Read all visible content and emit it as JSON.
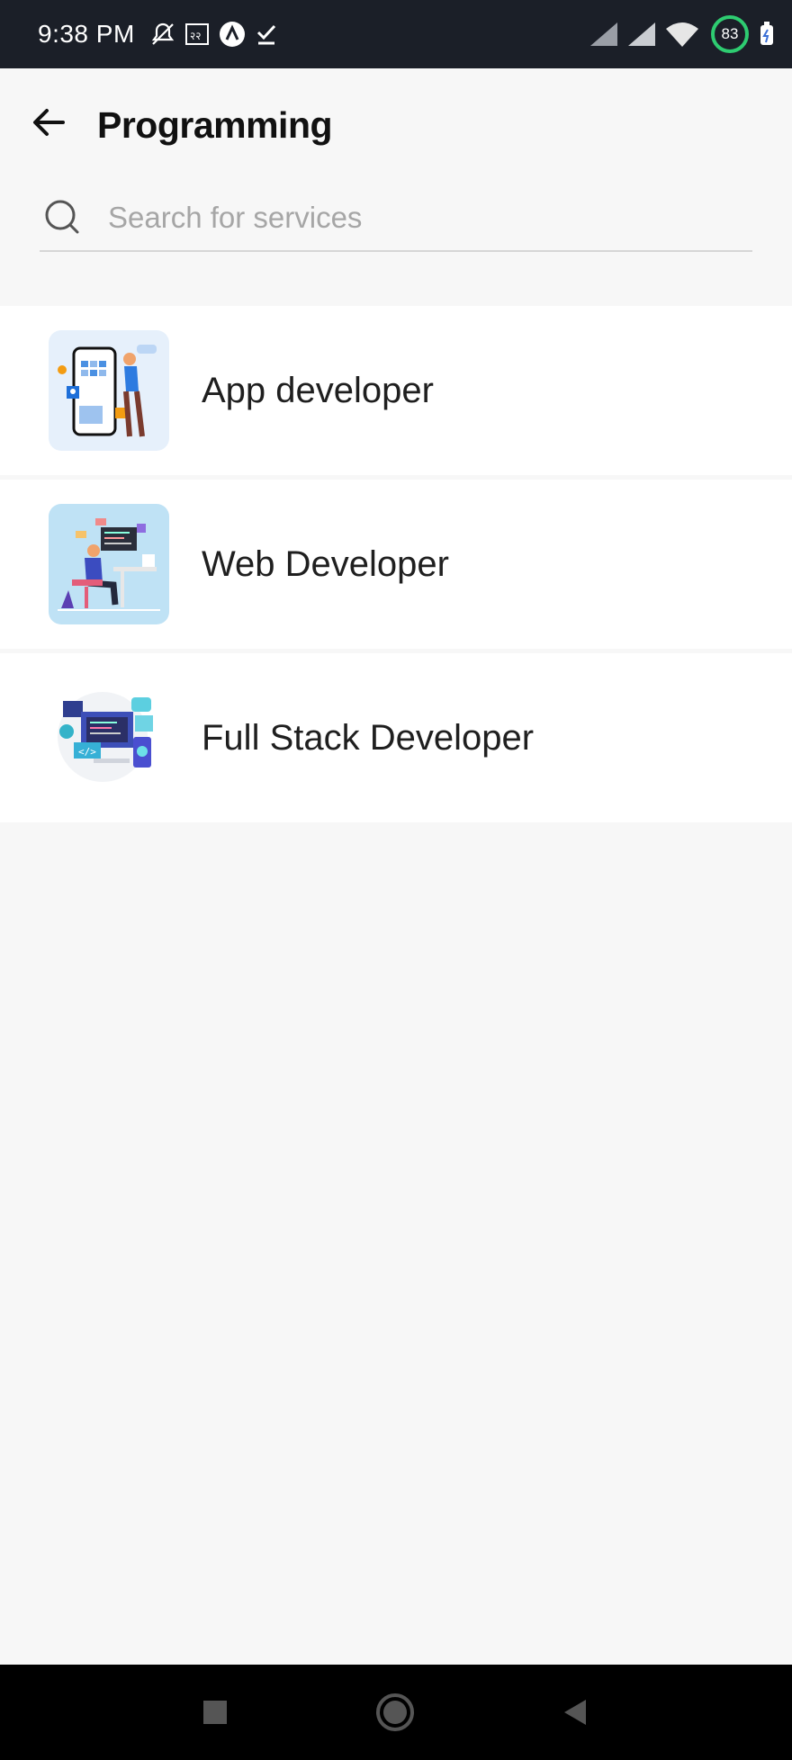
{
  "status_bar": {
    "time": "9:38 PM",
    "battery_level": "83",
    "icons": [
      "mute-icon",
      "sim-icon",
      "app-icon",
      "check-icon",
      "signal-icon",
      "signal-icon",
      "wifi-icon",
      "battery-icon",
      "usb-icon"
    ]
  },
  "header": {
    "title": "Programming",
    "back_icon": "arrow-left-icon"
  },
  "search": {
    "placeholder": "Search for services",
    "value": "",
    "icon": "search-icon"
  },
  "services": [
    {
      "label": "App developer",
      "thumb": "app-developer-illustration"
    },
    {
      "label": "Web Developer",
      "thumb": "web-developer-illustration"
    },
    {
      "label": "Full Stack Developer",
      "thumb": "full-stack-illustration"
    }
  ],
  "nav_bar": {
    "buttons": [
      "recents-square-icon",
      "home-circle-icon",
      "back-triangle-icon"
    ]
  },
  "colors": {
    "status_bar_bg": "#1b1f28",
    "page_bg": "#f7f7f7",
    "list_bg": "#ffffff",
    "battery_ring": "#2ecc71",
    "nav_bar_bg": "#000000"
  }
}
